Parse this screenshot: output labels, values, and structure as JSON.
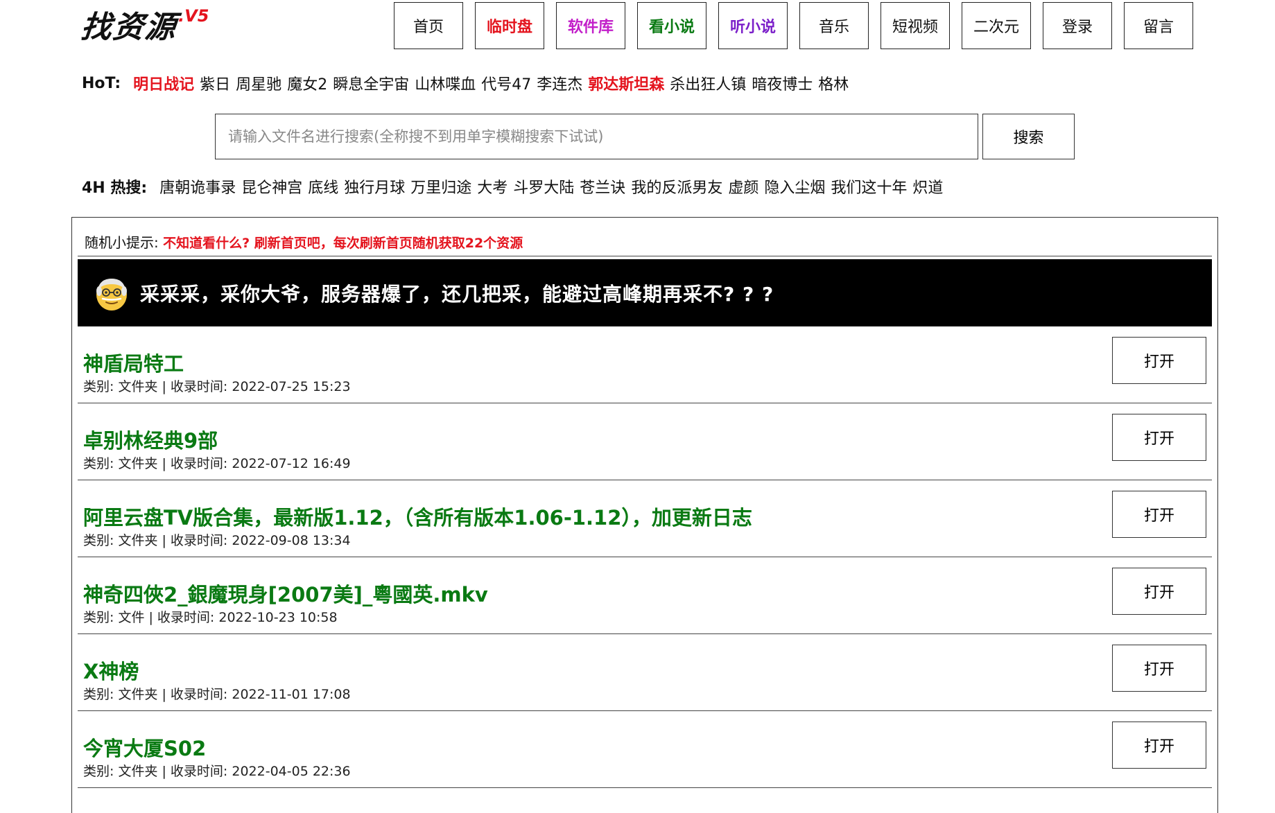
{
  "logo": {
    "text": "找资源",
    "version": ".V5"
  },
  "nav": [
    {
      "label": "首页",
      "color": "#111111",
      "bold": false
    },
    {
      "label": "临时盘",
      "color": "#e4141e",
      "bold": true
    },
    {
      "label": "软件库",
      "color": "#c21fc9",
      "bold": true
    },
    {
      "label": "看小说",
      "color": "#0a7a13",
      "bold": true
    },
    {
      "label": "听小说",
      "color": "#7b1fc9",
      "bold": true
    },
    {
      "label": "音乐",
      "color": "#111111",
      "bold": false
    },
    {
      "label": "短视频",
      "color": "#111111",
      "bold": false
    },
    {
      "label": "二次元",
      "color": "#111111",
      "bold": false
    },
    {
      "label": "登录",
      "color": "#111111",
      "bold": false
    },
    {
      "label": "留言",
      "color": "#111111",
      "bold": false
    }
  ],
  "hot": {
    "label": "HoT:",
    "keywords": [
      {
        "text": "明日战记",
        "highlight": true
      },
      {
        "text": "紫日",
        "highlight": false
      },
      {
        "text": "周星驰",
        "highlight": false
      },
      {
        "text": "魔女2",
        "highlight": false
      },
      {
        "text": "瞬息全宇宙",
        "highlight": false
      },
      {
        "text": "山林喋血",
        "highlight": false
      },
      {
        "text": "代号47",
        "highlight": false
      },
      {
        "text": "李连杰",
        "highlight": false
      },
      {
        "text": "郭达斯坦森",
        "highlight": true
      },
      {
        "text": "杀出狂人镇",
        "highlight": false
      },
      {
        "text": "暗夜博士",
        "highlight": false
      },
      {
        "text": "格林",
        "highlight": false
      }
    ]
  },
  "search": {
    "placeholder": "请输入文件名进行搜索(全称搜不到用单字模糊搜索下试试)",
    "value": "",
    "button": "搜索"
  },
  "hot4": {
    "label": "4H 热搜:",
    "keywords": [
      "唐朝诡事录",
      "昆仑神宫",
      "底线",
      "独行月球",
      "万里归途",
      "大考",
      "斗罗大陆",
      "苍兰诀",
      "我的反派男友",
      "虚颜",
      "隐入尘烟",
      "我们这十年",
      "炽道"
    ]
  },
  "tip": {
    "label": "随机小提示:",
    "text": "不知道看什么? 刷新首页吧，每次刷新首页随机获取22个资源"
  },
  "banner": {
    "icon": "old-man-emoji-icon",
    "text": "采采采，采你大爷，服务器爆了，还几把采，能避过高峰期再采不? ? ?"
  },
  "items": [
    {
      "title": "神盾局特工",
      "meta": "类别: 文件夹 | 收录时间: 2022-07-25 15:23",
      "button": "打开"
    },
    {
      "title": "卓别林经典9部",
      "meta": "类别: 文件夹 | 收录时间: 2022-07-12 16:49",
      "button": "打开"
    },
    {
      "title": "阿里云盘TV版合集，最新版1.12，（含所有版本1.06-1.12），加更新日志",
      "meta": "类别: 文件夹 | 收录时间: 2022-09-08 13:34",
      "button": "打开"
    },
    {
      "title": "神奇四俠2_銀魔現身[2007美]_粵國英.mkv",
      "meta": "类别: 文件 | 收录时间: 2022-10-23 10:58",
      "button": "打开"
    },
    {
      "title": "X神榜",
      "meta": "类别: 文件夹 | 收录时间: 2022-11-01 17:08",
      "button": "打开"
    },
    {
      "title": "今宵大厦S02",
      "meta": "类别: 文件夹 | 收录时间: 2022-04-05 22:36",
      "button": "打开"
    }
  ]
}
